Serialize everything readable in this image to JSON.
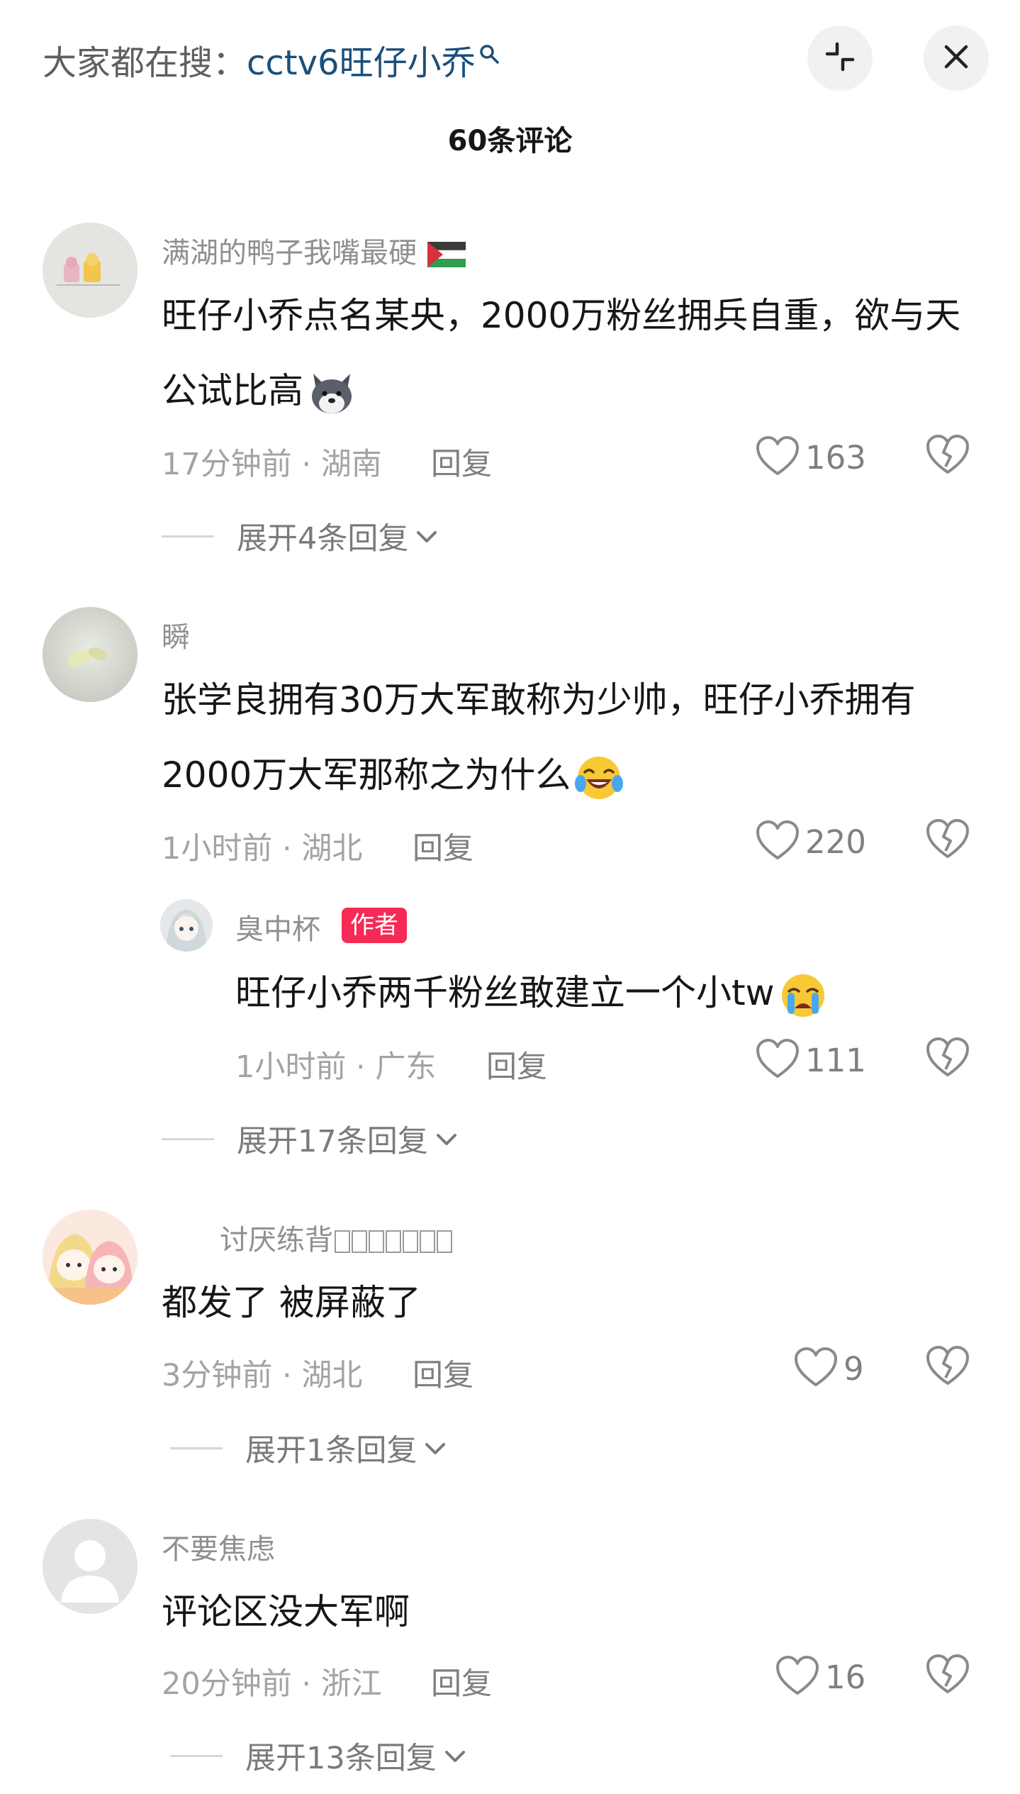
{
  "header": {
    "search_prefix": "大家都在搜：",
    "search_term": "cctv6旺仔小乔",
    "comment_count_title": "60条评论"
  },
  "colors": {
    "search_term": "#1b4f7a",
    "author_badge": "#f52a55",
    "muted_text": "#8f8f8f"
  },
  "comments": [
    {
      "username": "满湖的鸭子我嘴最硬",
      "username_icon": "palestine-flag-icon",
      "text": "旺仔小乔点名某央，2000万粉丝拥兵自重，欲与天公试比高",
      "text_emoji": "dog-emoji",
      "meta": "17分钟前 · 湖南",
      "reply_label": "回复",
      "likes": "163",
      "expand_label": "展开4条回复"
    },
    {
      "username": "瞬",
      "text": "张学良拥有30万大军敢称为少帅，旺仔小乔拥有2000万大军那称之为什么",
      "text_emoji": "laughing-tears-emoji",
      "meta": "1小时前 · 湖北",
      "reply_label": "回复",
      "likes": "220",
      "reply": {
        "username": "臭中杯",
        "badge": "作者",
        "text": "旺仔小乔两千粉丝敢建立一个小tw",
        "text_emoji": "crying-emoji",
        "meta": "1小时前 · 广东",
        "reply_label": "回复",
        "likes": "111"
      },
      "expand_label": "展开17条回复"
    },
    {
      "username": "讨厌练背",
      "text": "都发了 被屏蔽了",
      "meta": "3分钟前 · 湖北",
      "reply_label": "回复",
      "likes": "9",
      "expand_label": "展开1条回复"
    },
    {
      "username": "不要焦虑",
      "text": "评论区没大军啊",
      "meta": "20分钟前 · 浙江",
      "reply_label": "回复",
      "likes": "16",
      "expand_label": "展开13条回复"
    }
  ]
}
